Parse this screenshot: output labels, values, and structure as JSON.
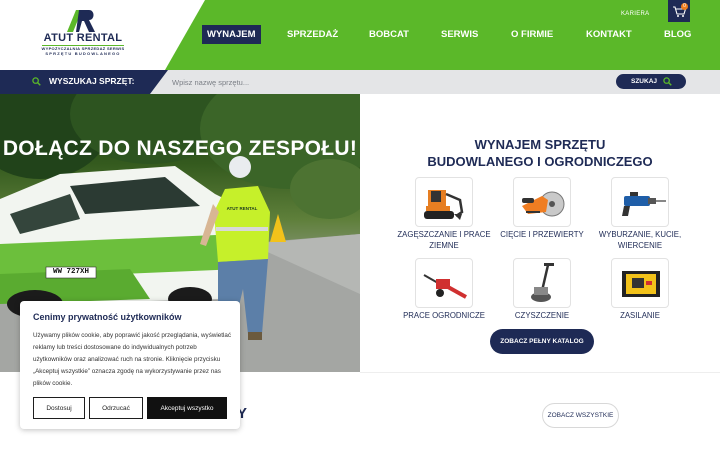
{
  "header": {
    "logo": {
      "name": "ATUT RENTAL",
      "tagline_1": "WYPOŻYCZALNIA SPRZEDAŻ SERWIS",
      "tagline_2": "SPRZĘTU BUDOWLANEGO"
    },
    "nav": [
      {
        "label": "WYNAJEM",
        "active": true
      },
      {
        "label": "SPRZEDAŻ"
      },
      {
        "label": "BOBCAT"
      },
      {
        "label": "SERWIS"
      },
      {
        "label": "O FIRMIE"
      },
      {
        "label": "KONTAKT"
      },
      {
        "label": "BLOG"
      }
    ],
    "kariera": "KARIERA",
    "cart_count": "0",
    "colors": {
      "green": "#5bb829",
      "navy": "#1e2a55"
    }
  },
  "search": {
    "label": "WYSZUKAJ SPRZĘT:",
    "placeholder": "Wpisz nazwę sprzętu...",
    "button": "SZUKAJ"
  },
  "hero": {
    "title": "DOŁĄCZ DO NASZEGO ZESPOŁU!",
    "vest_text": "ATUT RENTAL",
    "plate": "WW 727XH"
  },
  "rental": {
    "title_line1": "WYNAJEM SPRZĘTU",
    "title_line2": "BUDOWLANEGO I OGRODNICZEGO",
    "categories": [
      {
        "label": "ZAGĘSZCZANIE I PRACE ZIEMNE",
        "line1": "ZAGĘSZCZANIE I PRACE",
        "line2": "ZIEMNE",
        "icon": "mini-excavator-icon"
      },
      {
        "label": "CIĘCIE I PRZEWIERTY",
        "line1": "CIĘCIE I PRZEWIERTY",
        "line2": "",
        "icon": "cut-off-saw-icon"
      },
      {
        "label": "WYBURZANIE, KUCIE, WIERCENIE",
        "line1": "WYBURZANIE, KUCIE,",
        "line2": "WIERCENIE",
        "icon": "demolition-hammer-icon"
      },
      {
        "label": "PRACE OGRODNICZE",
        "line1": "PRACE OGRODNICZE",
        "line2": "",
        "icon": "trencher-icon"
      },
      {
        "label": "CZYSZCZENIE",
        "line1": "CZYSZCZENIE",
        "line2": "",
        "icon": "floor-grinder-icon"
      },
      {
        "label": "ZASILANIE",
        "line1": "ZASILANIE",
        "line2": "",
        "icon": "generator-icon"
      }
    ],
    "catalog_button": "ZOBACZ PEŁNY KATALOG"
  },
  "bottom": {
    "partial_heading": "Y",
    "see_all_button": "ZOBACZ WSZYSTKIE"
  },
  "cookie": {
    "title": "Cenimy prywatność użytkowników",
    "text": "Używamy plików cookie, aby poprawić jakość przeglądania, wyświetlać reklamy lub treści dostosowane do indywidualnych potrzeb użytkowników oraz analizować ruch na stronie. Kliknięcie przycisku „Akceptuj wszystkie” oznacza zgodę na wykorzystywanie przez nas plików cookie.",
    "customize": "Dostosuj",
    "reject": "Odrzucać",
    "accept": "Akceptuj wszystko"
  }
}
